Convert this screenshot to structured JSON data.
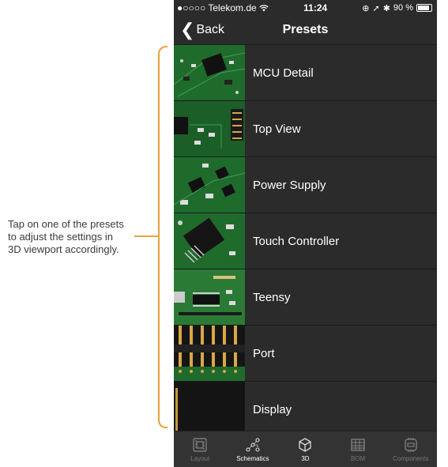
{
  "annotation": {
    "lines": [
      "Tap on one of the presets",
      "to adjust the settings in",
      "3D viewport accordingly."
    ]
  },
  "colors": {
    "accent": "#e9a23b",
    "background": "#2b2b2b",
    "pcb": "#1f6b2c"
  },
  "status_bar": {
    "carrier": "●○○○○ Telekom.de",
    "wifi_icon": "wifi-icon",
    "time": "11:24",
    "battery": "90 %"
  },
  "nav": {
    "back_label": "Back",
    "title": "Presets"
  },
  "presets": [
    {
      "label": "MCU Detail"
    },
    {
      "label": "Top View"
    },
    {
      "label": "Power Supply"
    },
    {
      "label": "Touch Controller"
    },
    {
      "label": "Teensy"
    },
    {
      "label": "Port"
    },
    {
      "label": "Display"
    }
  ],
  "tabs": [
    {
      "label": "Layout",
      "icon": "layout-icon"
    },
    {
      "label": "Schematics",
      "icon": "schematics-icon"
    },
    {
      "label": "3D",
      "icon": "cube-icon"
    },
    {
      "label": "BOM",
      "icon": "grid-icon"
    },
    {
      "label": "Components",
      "icon": "component-icon"
    }
  ]
}
